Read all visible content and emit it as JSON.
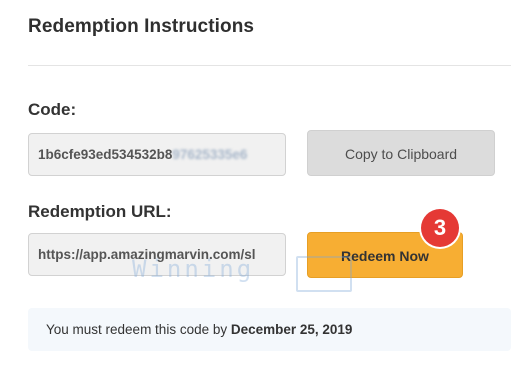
{
  "header": {
    "title": "Redemption Instructions"
  },
  "code_section": {
    "label": "Code:",
    "value_visible": "1b6cfe93ed534532b8",
    "value_obscured": "97625335e6",
    "copy_button_label": "Copy to Clipboard"
  },
  "url_section": {
    "label": "Redemption URL:",
    "value": "https://app.amazingmarvin.com/sl",
    "redeem_button_label": "Redeem Now"
  },
  "annotation": {
    "step_number": "3",
    "badge_color": "#e53935"
  },
  "watermark": {
    "text": "Winning"
  },
  "notice": {
    "prefix": "You must redeem this code by ",
    "deadline": "December 25, 2019"
  },
  "colors": {
    "accent": "#f7ae33",
    "notice_bg": "#f4f8fc"
  }
}
